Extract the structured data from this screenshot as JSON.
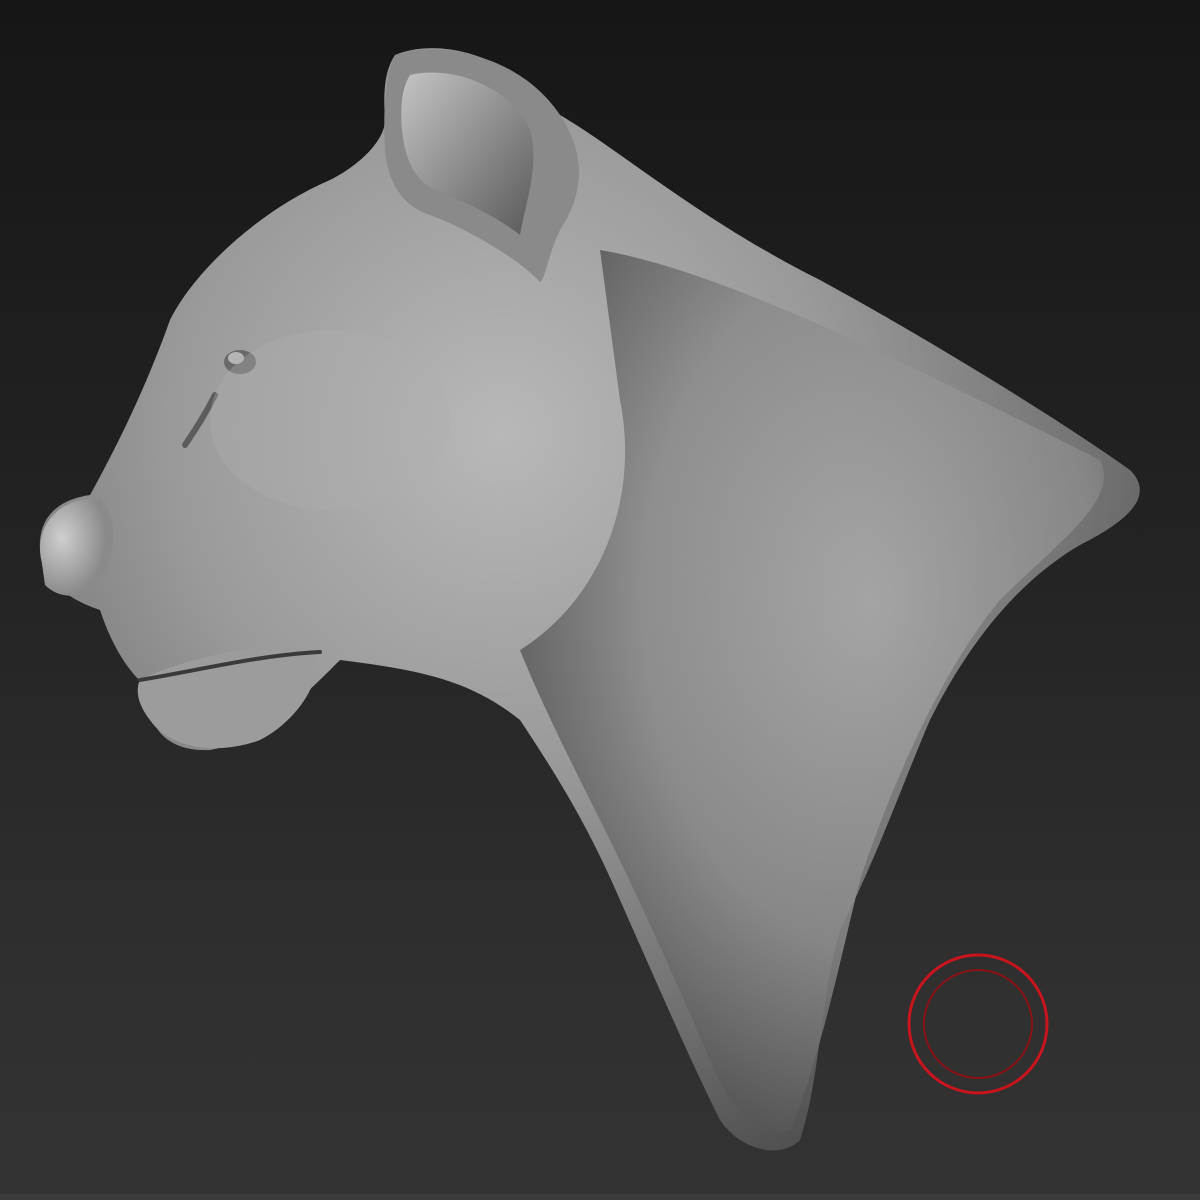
{
  "app": {
    "viewport": "sculpting-viewport"
  },
  "model": {
    "subject": "lioness-head-sculpt",
    "material_color": "#8c8c8c"
  },
  "brush": {
    "icon": "brush-cursor-icon",
    "color": "#c8141c"
  },
  "colors": {
    "background_top": "#161616",
    "background_bottom": "#333333"
  }
}
